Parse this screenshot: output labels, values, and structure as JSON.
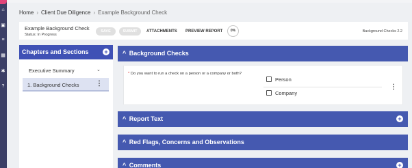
{
  "breadcrumb": {
    "items": [
      "Home",
      "Client Due Diligence",
      "Example Background Check"
    ],
    "separator": "›"
  },
  "header": {
    "title": "Example Background Check",
    "status": "Status: In Progress",
    "save_label": "SAVE",
    "submit_label": "SUBMIT",
    "attachments_label": "ATTACHMENTS",
    "preview_label": "PREVIEW REPORT",
    "progress_label": "0%",
    "version": "Background Checks 2.2"
  },
  "sidebar": {
    "title": "Chapters and Sections",
    "chapter": "Executive Summary",
    "section": "1. Background Checks"
  },
  "panels": {
    "background_checks": "Background Checks",
    "report_text": "Report Text",
    "red_flags": "Red Flags, Concerns and Observations",
    "comments": "Comments"
  },
  "question": {
    "required_mark": "*",
    "text": "Do you want to run a check on a person or a company or both?",
    "options": [
      "Person",
      "Company"
    ]
  },
  "colors": {
    "primary": "#3f51b5",
    "nav_dark": "#3b3f66",
    "brand_pink": "#e2457a",
    "selected_bg": "#dde2f2"
  },
  "icons": {
    "nav": [
      "home-icon",
      "calendar-icon",
      "list-icon",
      "grid-icon",
      "settings-icon",
      "help-icon"
    ],
    "panel": [
      "chevron-up-icon",
      "add-icon",
      "more-vert-icon",
      "chevron-down-icon"
    ]
  }
}
